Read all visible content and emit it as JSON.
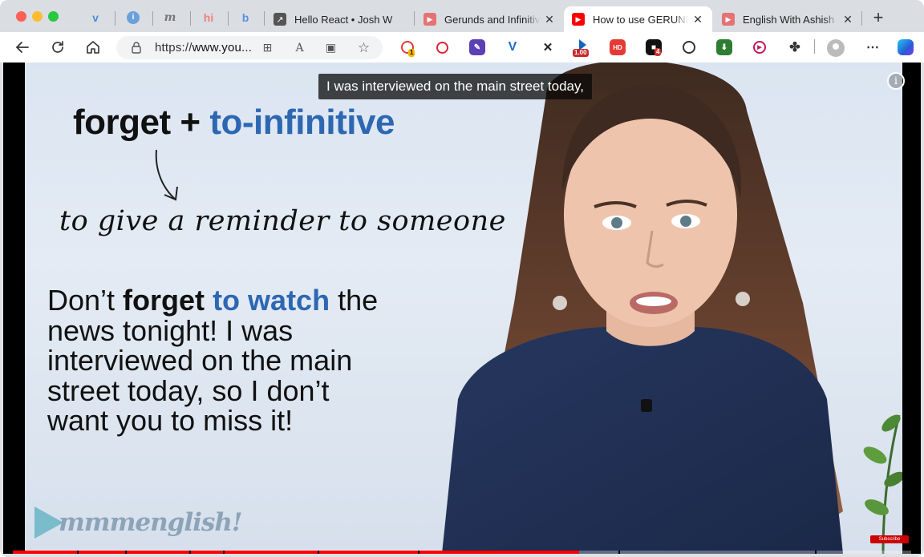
{
  "browser": {
    "tabs": [
      {
        "title": "Hello React • Josh W",
        "favicon": "arrow-icon"
      },
      {
        "title": "Gerunds and Infinitive",
        "favicon": "youtube-icon"
      },
      {
        "title": "How to use GERUNDS",
        "favicon": "youtube-icon",
        "active": true
      },
      {
        "title": "English With Ashish",
        "favicon": "youtube-icon"
      }
    ],
    "pinned_tabs": [
      "v",
      "i",
      "m",
      "hi",
      "b"
    ],
    "address": {
      "prefix": "https://",
      "host": "www.you..."
    },
    "extension_badges": {
      "first": "1",
      "speed": "1.00",
      "hd": "HD",
      "count": "4"
    }
  },
  "video": {
    "slide": {
      "heading_verb": "forget",
      "heading_plus": "+",
      "heading_form": "to-infinitive",
      "meaning": "to give a reminder to someone",
      "example_pre": "Don’t ",
      "example_verb": "forget",
      "example_space": " ",
      "example_inf": "to watch",
      "example_rest_1": " the",
      "example_line2": "news tonight! I was",
      "example_line3": "interviewed on the main",
      "example_line4": "street today, so I don’t",
      "example_line5": "want you to miss it!",
      "logo_text": "mmmenglish!"
    },
    "caption": "I was interviewed on the main street today,",
    "subscribe_label": "Subscribe",
    "progress_fraction": 0.63
  },
  "colors": {
    "accent_blue": "#2d67b2",
    "youtube_red": "#ff0000"
  }
}
